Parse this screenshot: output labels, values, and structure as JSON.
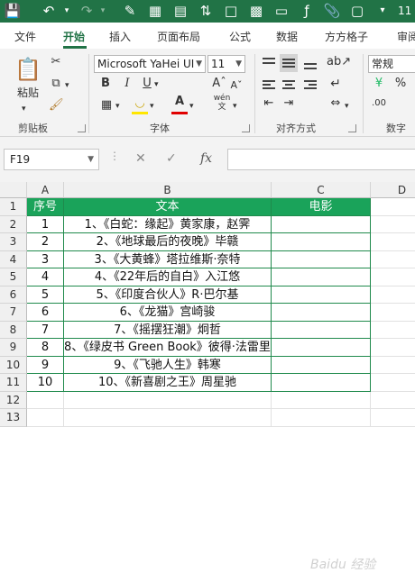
{
  "app": {
    "window_count": "11"
  },
  "quick_access": [
    "save-icon",
    "undo-icon",
    "redo-icon",
    "format-painter-icon",
    "table-icon",
    "chart-icon",
    "sort-icon",
    "doc-icon",
    "screen-icon",
    "page-icon",
    "function-icon",
    "clip-icon",
    "frame-icon",
    "dropdown-icon"
  ],
  "tabs": [
    {
      "label": "文件"
    },
    {
      "label": "开始"
    },
    {
      "label": "插入"
    },
    {
      "label": "页面布局"
    },
    {
      "label": "公式"
    },
    {
      "label": "数据"
    },
    {
      "label": "方方格子"
    },
    {
      "label": "审阅"
    }
  ],
  "ribbon": {
    "clipboard": {
      "label": "剪贴板",
      "paste_label": "粘贴"
    },
    "font": {
      "label": "字体",
      "font_name": "Microsoft YaHei UI",
      "font_size": "11",
      "bold": "B",
      "italic": "I",
      "underline": "U",
      "phonetic": "wén"
    },
    "alignment": {
      "label": "对齐方式"
    },
    "number": {
      "label": "数字",
      "format": "常规"
    }
  },
  "formula_bar": {
    "name_box": "F19",
    "fx": "fx",
    "cancel": "✕",
    "enter": "✓",
    "formula": ""
  },
  "columns": [
    "A",
    "B",
    "C",
    "D"
  ],
  "rows": [
    "1",
    "2",
    "3",
    "4",
    "5",
    "6",
    "7",
    "8",
    "9",
    "10",
    "11",
    "12",
    "13"
  ],
  "table": {
    "headers": [
      "序号",
      "文本",
      "电影"
    ],
    "rows": [
      {
        "no": "1",
        "text": "1、《白蛇：缘起》黄家康，赵霁"
      },
      {
        "no": "2",
        "text": "2、《地球最后的夜晚》毕赣"
      },
      {
        "no": "3",
        "text": "3、《大黄蜂》塔拉维斯·奈特"
      },
      {
        "no": "4",
        "text": "4、《22年后的自白》入江悠"
      },
      {
        "no": "5",
        "text": "5、《印度合伙人》R·巴尔基"
      },
      {
        "no": "6",
        "text": "6、《龙猫》宫崎骏"
      },
      {
        "no": "7",
        "text": "7、《摇摆狂潮》炯哲"
      },
      {
        "no": "8",
        "text": "8、《绿皮书 Green Book》彼得·法雷里"
      },
      {
        "no": "9",
        "text": "9、《飞驰人生》韩寒"
      },
      {
        "no": "10",
        "text": "10、《新喜剧之王》周星驰"
      }
    ]
  },
  "watermark": "Baidu 经验",
  "colors": {
    "excel_green": "#217346",
    "header_fill": "#1aa35a",
    "border_green": "#1f8a4c"
  }
}
